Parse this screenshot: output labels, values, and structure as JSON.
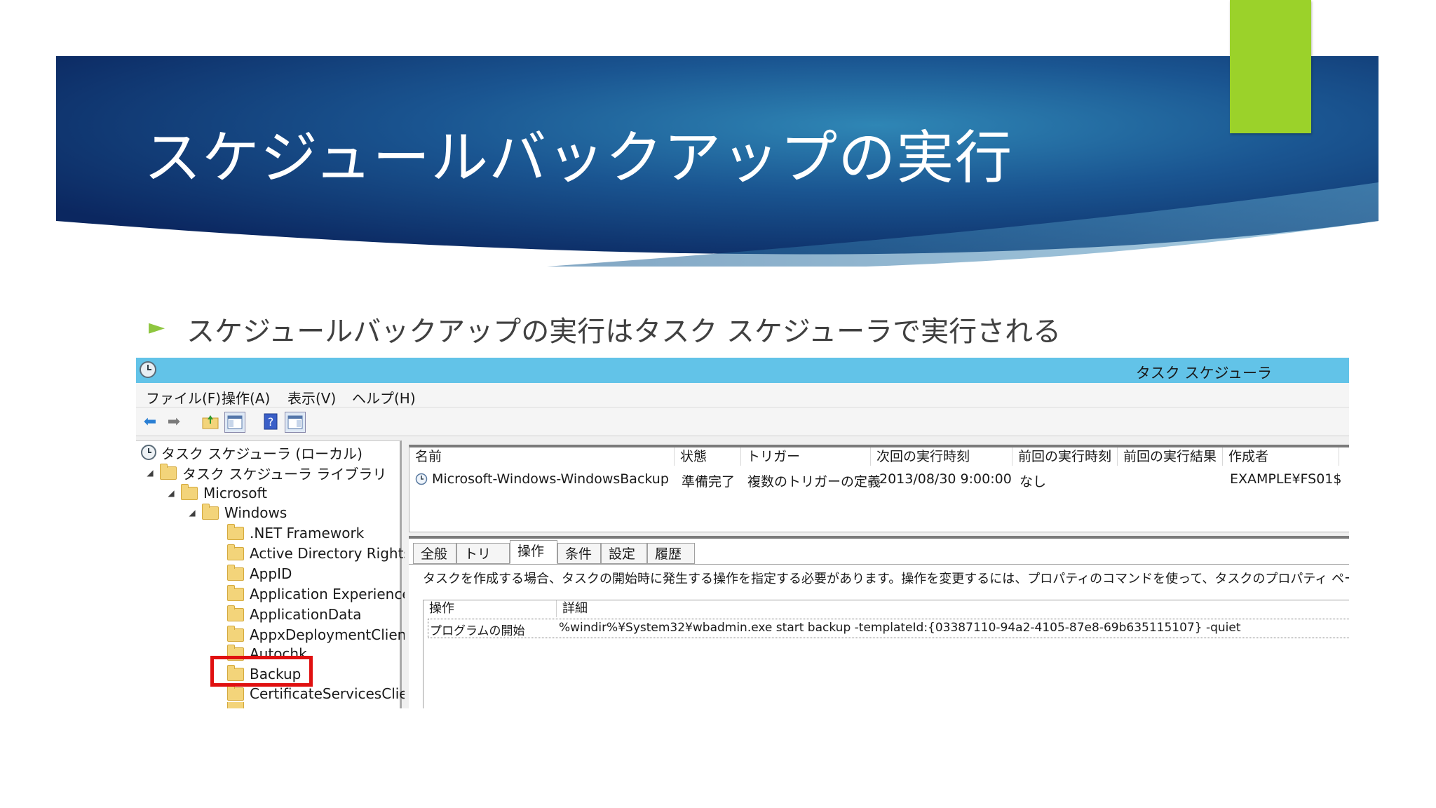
{
  "slide": {
    "title": "スケジュールバックアップの実行",
    "bullet_icon": "►",
    "bullet_text": "スケジュールバックアップの実行はタスク スケジューラで実行される",
    "colors": {
      "banner_dark": "#0d2a63",
      "banner_light": "#2e7fb1",
      "accent_green": "#9bd22a",
      "highlight_red": "#e01010"
    }
  },
  "window": {
    "title": "タスク スケジューラ",
    "menu": [
      "ファイル(F)",
      "操作(A)",
      "表示(V)",
      "ヘルプ(H)"
    ]
  },
  "tree": {
    "root": "タスク スケジューラ (ローカル)",
    "library": "タスク スケジューラ ライブラリ",
    "microsoft": "Microsoft",
    "windows": "Windows",
    "folders": [
      ".NET Framework",
      "Active Directory Rights",
      "AppID",
      "Application Experience",
      "ApplicationData",
      "AppxDeploymentClient",
      "Autochk",
      "Backup",
      "CertificateServicesClie"
    ]
  },
  "task_list": {
    "columns": [
      "名前",
      "状態",
      "トリガー",
      "次回の実行時刻",
      "前回の実行時刻",
      "前回の実行結果",
      "作成者"
    ],
    "row": {
      "name": "Microsoft-Windows-WindowsBackup",
      "status": "準備完了",
      "trigger": "複数のトリガーの定義",
      "next_run": "2013/08/30 9:00:00",
      "last_run": "なし",
      "last_result": "",
      "author": "EXAMPLE¥FS01$"
    }
  },
  "details": {
    "tabs": [
      "全般",
      "トリガー",
      "操作",
      "条件",
      "設定",
      "履歴"
    ],
    "active_tab": "操作",
    "description": "タスクを作成する場合、タスクの開始時に発生する操作を指定する必要があります。操作を変更するには、プロパティのコマンドを使って、タスクのプロパティ ページを開いてください。",
    "action_columns": [
      "操作",
      "詳細"
    ],
    "action_row": {
      "action": "プログラムの開始",
      "detail": "%windir%¥System32¥wbadmin.exe start backup -templateId:{03387110-94a2-4105-87e8-69b635115107} -quiet"
    }
  }
}
